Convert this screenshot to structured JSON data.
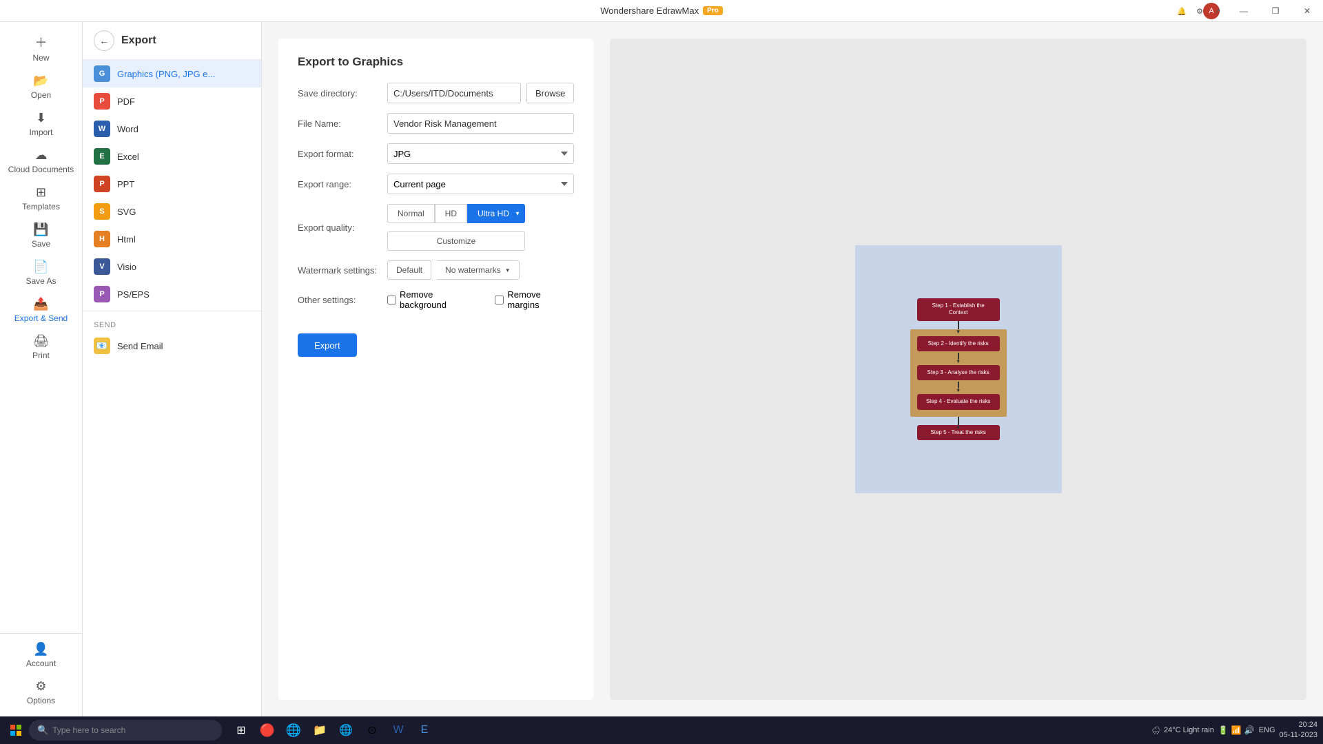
{
  "app": {
    "title": "Wondershare EdrawMax",
    "pro_badge": "Pro"
  },
  "titlebar": {
    "minimize": "—",
    "restore": "❐",
    "close": "✕"
  },
  "toolbar": {
    "icons": [
      "⚙",
      "🔔",
      "☰",
      "↩",
      "↪"
    ]
  },
  "sidebar_narrow": {
    "items": [
      {
        "id": "new",
        "label": "New",
        "icon": "+"
      },
      {
        "id": "open",
        "label": "Open",
        "icon": "📂"
      },
      {
        "id": "import",
        "label": "Import",
        "icon": "⬇"
      },
      {
        "id": "cloud",
        "label": "Cloud Documents",
        "icon": "☁"
      },
      {
        "id": "templates",
        "label": "Templates",
        "icon": "⊞"
      },
      {
        "id": "save",
        "label": "Save",
        "icon": "💾"
      },
      {
        "id": "saveas",
        "label": "Save As",
        "icon": "📄"
      },
      {
        "id": "export",
        "label": "Export & Send",
        "icon": "📤"
      },
      {
        "id": "print",
        "label": "Print",
        "icon": "🖨"
      }
    ],
    "bottom": [
      {
        "id": "account",
        "label": "Account",
        "icon": "👤"
      },
      {
        "id": "options",
        "label": "Options",
        "icon": "⚙"
      }
    ]
  },
  "export_sidebar": {
    "title": "Export",
    "formats": [
      {
        "id": "graphics",
        "label": "Graphics (PNG, JPG e...",
        "color": "graphics",
        "active": true
      },
      {
        "id": "pdf",
        "label": "PDF",
        "color": "pdf"
      },
      {
        "id": "word",
        "label": "Word",
        "color": "word"
      },
      {
        "id": "excel",
        "label": "Excel",
        "color": "excel"
      },
      {
        "id": "ppt",
        "label": "PPT",
        "color": "ppt"
      },
      {
        "id": "svg",
        "label": "SVG",
        "color": "svg"
      },
      {
        "id": "html",
        "label": "Html",
        "color": "html"
      },
      {
        "id": "visio",
        "label": "Visio",
        "color": "visio"
      },
      {
        "id": "pseps",
        "label": "PS/EPS",
        "color": "pseps"
      }
    ],
    "send_section_label": "Send",
    "send_items": [
      {
        "id": "send_email",
        "label": "Send Email"
      }
    ]
  },
  "export_form": {
    "title": "Export to Graphics",
    "save_directory_label": "Save directory:",
    "save_directory_value": "C:/Users/ITD/Documents",
    "browse_label": "Browse",
    "file_name_label": "File Name:",
    "file_name_value": "Vendor Risk Management",
    "export_format_label": "Export format:",
    "export_format_value": "JPG",
    "export_range_label": "Export range:",
    "export_range_value": "Current page",
    "export_quality_label": "Export quality:",
    "quality_normal": "Normal",
    "quality_hd": "HD",
    "quality_ultra_hd": "Ultra HD",
    "customize_label": "Customize",
    "watermark_label": "Watermark settings:",
    "watermark_default": "Default",
    "watermark_no_watermarks": "No watermarks",
    "other_settings_label": "Other settings:",
    "remove_background_label": "Remove background",
    "remove_margins_label": "Remove margins",
    "export_btn": "Export"
  },
  "preview": {
    "flow_steps": [
      "Step 1 - Establish the Context",
      "Step 2 - Identify the risks",
      "Step 3 - Analyse the risks",
      "Step 4 - Evaluate the risks",
      "Step 5 - Treat the risks"
    ]
  },
  "taskbar": {
    "search_placeholder": "Type here to search",
    "weather": "24°C  Light rain",
    "time": "20:24",
    "date": "05-11-2023",
    "lang": "ENG"
  }
}
